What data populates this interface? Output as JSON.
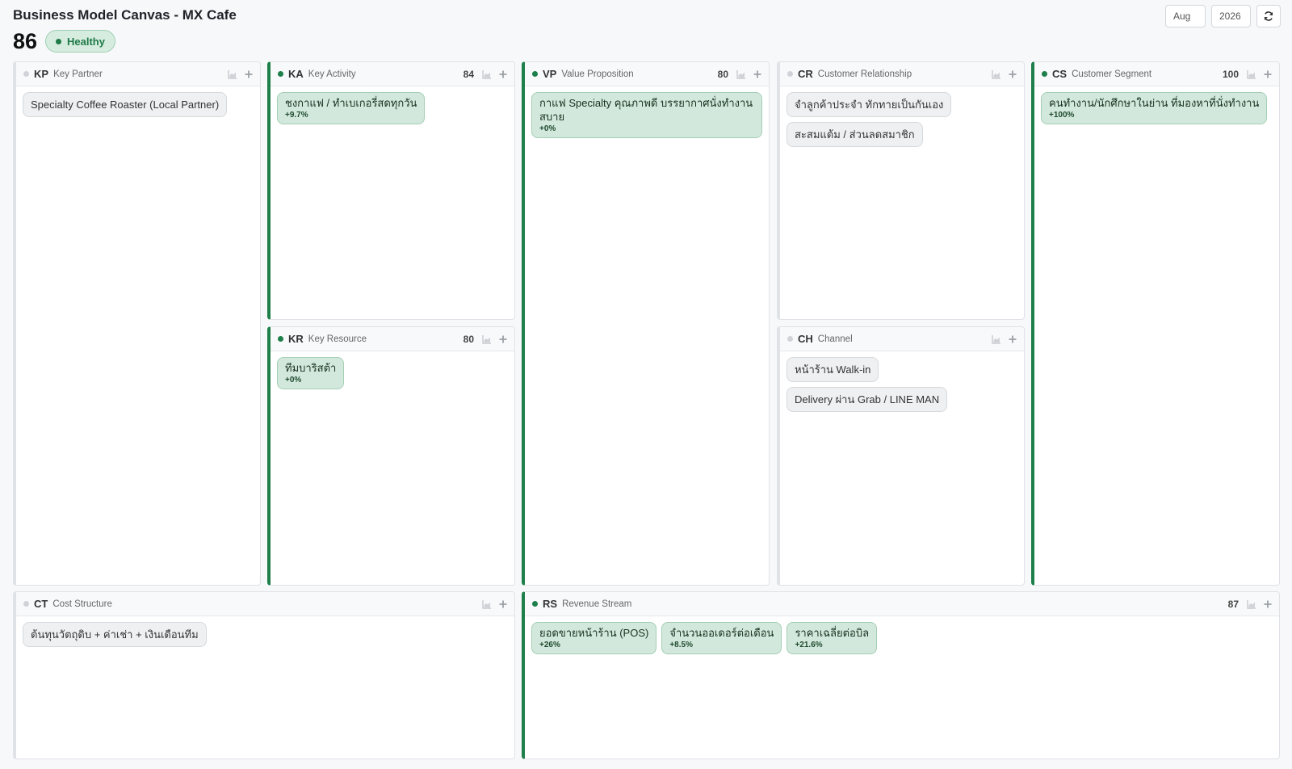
{
  "header": {
    "title": "Business Model Canvas - MX Cafe",
    "score": "86",
    "health": "Healthy",
    "month": "Aug",
    "year": "2026"
  },
  "colors": {
    "accent_green": "#1d7f4a",
    "chip_green_bg": "#d3e8dc",
    "chip_gray_bg": "#eef0f2"
  },
  "blocks": {
    "kp": {
      "code": "KP",
      "name": "Key Partner",
      "score": "",
      "status": "inactive",
      "items": [
        {
          "text": "Specialty Coffee Roaster (Local Partner)"
        }
      ]
    },
    "ka": {
      "code": "KA",
      "name": "Key Activity",
      "score": "84",
      "status": "active",
      "items": [
        {
          "text": "ชงกาแฟ / ทำเบเกอรี่สดทุกวัน",
          "change": "+9.7%"
        }
      ]
    },
    "kr": {
      "code": "KR",
      "name": "Key Resource",
      "score": "80",
      "status": "active",
      "items": [
        {
          "text": "ทีมบาริสต้า",
          "change": "+0%"
        }
      ]
    },
    "vp": {
      "code": "VP",
      "name": "Value Proposition",
      "score": "80",
      "status": "active",
      "items": [
        {
          "text": "กาแฟ Specialty คุณภาพดี บรรยากาศนั่งทำงานสบาย",
          "change": "+0%"
        }
      ]
    },
    "cr": {
      "code": "CR",
      "name": "Customer Relationship",
      "score": "",
      "status": "inactive",
      "items": [
        {
          "text": "จำลูกค้าประจำ ทักทายเป็นกันเอง"
        },
        {
          "text": "สะสมแต้ม / ส่วนลดสมาชิก"
        }
      ]
    },
    "ch": {
      "code": "CH",
      "name": "Channel",
      "score": "",
      "status": "inactive",
      "items": [
        {
          "text": "หน้าร้าน Walk-in"
        },
        {
          "text": "Delivery ผ่าน Grab / LINE MAN"
        }
      ]
    },
    "cs": {
      "code": "CS",
      "name": "Customer Segment",
      "score": "100",
      "status": "active",
      "items": [
        {
          "text": "คนทำงาน/นักศึกษาในย่าน ที่มองหาที่นั่งทำงาน",
          "change": "+100%"
        }
      ]
    },
    "ct": {
      "code": "CT",
      "name": "Cost Structure",
      "score": "",
      "status": "inactive",
      "items": [
        {
          "text": "ต้นทุนวัตถุดิบ + ค่าเช่า + เงินเดือนทีม"
        }
      ]
    },
    "rs": {
      "code": "RS",
      "name": "Revenue Stream",
      "score": "87",
      "status": "active",
      "items": [
        {
          "text": "ยอดขายหน้าร้าน (POS)",
          "change": "+26%"
        },
        {
          "text": "จำนวนออเดอร์ต่อเดือน",
          "change": "+8.5%"
        },
        {
          "text": "ราคาเฉลี่ยต่อบิล",
          "change": "+21.6%"
        }
      ]
    }
  }
}
